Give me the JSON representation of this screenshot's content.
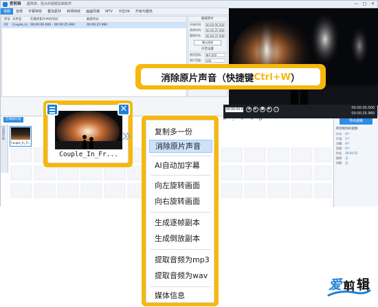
{
  "app": {
    "name": "爱剪辑",
    "slogan": "超简单、强大的视频剪辑软件",
    "window_buttons": [
      "—",
      "□",
      "✕"
    ]
  },
  "menu": {
    "items": [
      "视频",
      "音频",
      "字幕特效",
      "叠加素材",
      "转场特效",
      "画面风格",
      "MTV",
      "卡拉OK",
      "升级与服务"
    ],
    "active_index": 0
  },
  "file_list": {
    "headers": [
      "序号",
      "文件名",
      "在最终影片中的时间",
      "截取时长"
    ],
    "rows": [
      [
        "01",
        "Couple_In_Fr...",
        "00:00:00.000 - 00:00:25.960",
        "00:00:25.960"
      ]
    ]
  },
  "settings": {
    "title1": "截取原片",
    "rows1": [
      {
        "label": "开始时间:",
        "value": "00:00:00.000"
      },
      {
        "label": "结束时间:",
        "value": "00:00:25.960"
      },
      {
        "label": "截取时长:",
        "value": "00:00:25.960"
      }
    ],
    "confirm_label": "确认修改",
    "title2": "声音设置",
    "rows2": [
      {
        "label": "使用音轨:",
        "value": "原片声音"
      },
      {
        "label": "原片音量:",
        "value": "100"
      }
    ],
    "checkbox_label": "头尾声音淡入淡出"
  },
  "player": {
    "time_input": "00:00:00.000",
    "current_time": "00:00:00.000",
    "total_time": "00:00:25.960"
  },
  "timeline": {
    "tab_label": "已添加片段",
    "track_label": "已添加片段",
    "small_clip_label": "Couple_In_Fr..."
  },
  "right_panel": {
    "export_label": "导出视频",
    "title": "所有制作的视频",
    "rows": [
      {
        "label": "片头:",
        "value": "0个"
      },
      {
        "label": "片段:",
        "value": "1个"
      },
      {
        "label": "字幕:",
        "value": "0个"
      },
      {
        "label": "音频:",
        "value": "0个"
      },
      {
        "label": "时长:",
        "value": "00:00:25"
      },
      {
        "label": "画质:",
        "value": "无"
      },
      {
        "label": "风格:",
        "value": "无"
      }
    ]
  },
  "callout": {
    "main_text": "消除原片声音（快捷键 ",
    "shortcut": "Ctrl+W",
    "end_text": "）"
  },
  "clip_card": {
    "name": "Couple_In_Fr...",
    "menu_icon": "list-icon",
    "close_icon": "close-icon"
  },
  "context_menu": {
    "items": [
      "复制多一份",
      "消除原片声音",
      "AI自动加字幕",
      "向左旋转画面",
      "向右旋转画面",
      "生成逐帧副本",
      "生成倒放副本",
      "提取音频为mp3",
      "提取音频为wav",
      "媒体信息"
    ],
    "highlighted_index": 1
  },
  "logo": {
    "char1": "爱",
    "char2": "剪",
    "char3": "辑"
  },
  "colors": {
    "accent_yellow": "#f6b80d",
    "accent_blue": "#2f8de4",
    "highlight_bg": "#cde3fb"
  }
}
